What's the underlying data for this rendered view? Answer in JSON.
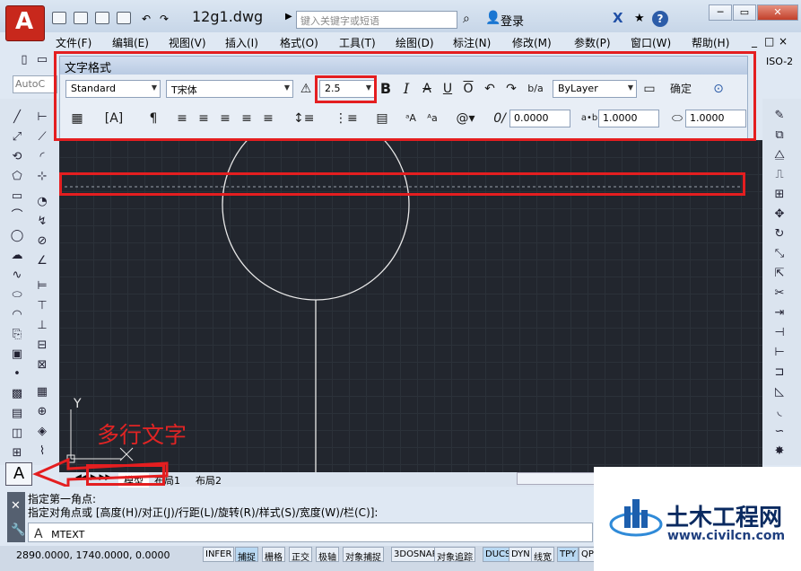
{
  "title": {
    "doc": "12g1.dwg",
    "search_placeholder": "键入关键字或短语",
    "login": "登录",
    "win_min": "─",
    "win_restore": "▭",
    "win_close": "✕"
  },
  "menu": [
    "文件(F)",
    "编辑(E)",
    "视图(V)",
    "插入(I)",
    "格式(O)",
    "工具(T)",
    "绘图(D)",
    "标注(N)",
    "修改(M)",
    "参数(P)",
    "窗口(W)",
    "帮助(H)"
  ],
  "menubar_right": [
    "_",
    "□",
    "×"
  ],
  "workspace": {
    "tb3": "AutoC",
    "iso": "ISO-2"
  },
  "textformat": {
    "title": "文字格式",
    "style": "Standard",
    "font": "T宋体",
    "height": "2.5",
    "color": "ByLayer",
    "ok": "确定",
    "oblique": "0.0000",
    "tracking": "1.0000",
    "width_factor": "1.0000"
  },
  "tabs": [
    "模型",
    "布局1",
    "布局2"
  ],
  "command": {
    "line1": "指定第一角点:",
    "line2": "指定对角点或 [高度(H)/对正(J)/行距(L)/旋转(R)/样式(S)/宽度(W)/栏(C)]:",
    "prompt_icon": "A",
    "input": "MTEXT"
  },
  "status": {
    "coords": "2890.0000, 1740.0000, 0.0000",
    "buttons": [
      "INFER",
      "捕捉",
      "栅格",
      "正交",
      "极轴",
      "对象捕捉",
      "3DOSNAP",
      "对象追踪",
      "DUCS",
      "DYN",
      "线宽",
      "TPY",
      "QP"
    ]
  },
  "annotation": "多行文字",
  "watermark": {
    "title": "土木工程网",
    "url": "www.civilcn.com"
  },
  "ucs": {
    "y": "Y"
  },
  "colors": {
    "accent_red": "#e41e20",
    "canvas": "#22262e",
    "app_red": "#c8281c"
  }
}
